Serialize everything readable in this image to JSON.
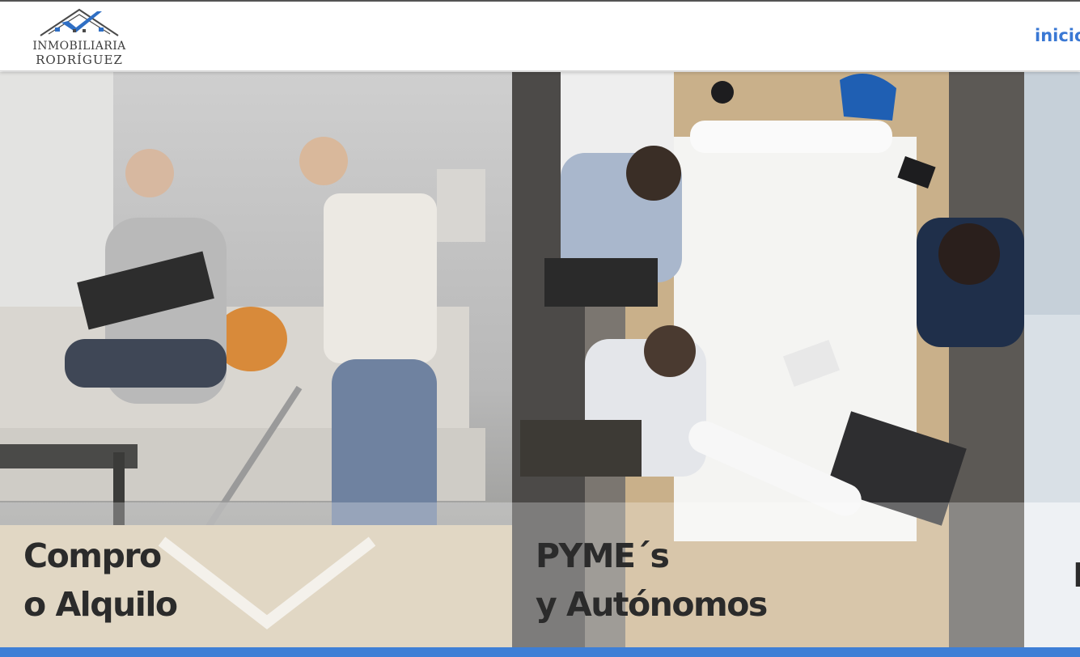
{
  "brand": {
    "name_line1": "INMOBILIARIA",
    "name_line2": "RODRÍGUEZ",
    "logo_icon": "house-roof-check-icon",
    "logo_color": "#2f6fc4"
  },
  "nav": {
    "items": [
      {
        "label": "inicio"
      }
    ],
    "color": "#3a78d4"
  },
  "panels": [
    {
      "line1": "Compro",
      "line2": "o Alquilo",
      "image": "family-living-room-photo"
    },
    {
      "line1": "PYME´s",
      "line2": "y Autónomos",
      "image": "office-team-blueprints-photo"
    },
    {
      "line1": "I",
      "image": "third-panel-photo"
    }
  ],
  "colors": {
    "accent": "#3e7fd6",
    "caption_text": "#2b2b2b"
  }
}
